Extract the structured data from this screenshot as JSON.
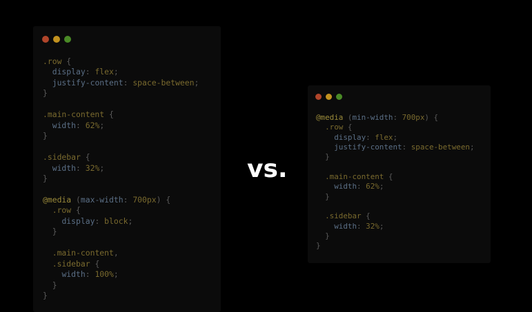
{
  "vs_label": "vs.",
  "colors": {
    "background": "#000000",
    "window": "#0b0b0b",
    "dot_red": "#b0452a",
    "dot_yellow": "#c2921f",
    "dot_green": "#4a8a26"
  },
  "left_window": {
    "dots": [
      "red",
      "yellow",
      "green"
    ],
    "lines": [
      [
        {
          "t": "sel",
          "v": ".row"
        },
        {
          "t": "punc",
          "v": " {"
        }
      ],
      [
        {
          "t": "punc",
          "v": "  "
        },
        {
          "t": "prop",
          "v": "display"
        },
        {
          "t": "punc",
          "v": ": "
        },
        {
          "t": "val",
          "v": "flex"
        },
        {
          "t": "punc",
          "v": ";"
        }
      ],
      [
        {
          "t": "punc",
          "v": "  "
        },
        {
          "t": "prop",
          "v": "justify-content"
        },
        {
          "t": "punc",
          "v": ": "
        },
        {
          "t": "val",
          "v": "space-between"
        },
        {
          "t": "punc",
          "v": ";"
        }
      ],
      [
        {
          "t": "punc",
          "v": "}"
        }
      ],
      [],
      [
        {
          "t": "sel",
          "v": ".main-content"
        },
        {
          "t": "punc",
          "v": " {"
        }
      ],
      [
        {
          "t": "punc",
          "v": "  "
        },
        {
          "t": "prop",
          "v": "width"
        },
        {
          "t": "punc",
          "v": ": "
        },
        {
          "t": "val",
          "v": "62%"
        },
        {
          "t": "punc",
          "v": ";"
        }
      ],
      [
        {
          "t": "punc",
          "v": "}"
        }
      ],
      [],
      [
        {
          "t": "sel",
          "v": ".sidebar"
        },
        {
          "t": "punc",
          "v": " {"
        }
      ],
      [
        {
          "t": "punc",
          "v": "  "
        },
        {
          "t": "prop",
          "v": "width"
        },
        {
          "t": "punc",
          "v": ": "
        },
        {
          "t": "val",
          "v": "32%"
        },
        {
          "t": "punc",
          "v": ";"
        }
      ],
      [
        {
          "t": "punc",
          "v": "}"
        }
      ],
      [],
      [
        {
          "t": "at",
          "v": "@media"
        },
        {
          "t": "punc",
          "v": " ("
        },
        {
          "t": "arg",
          "v": "max-width"
        },
        {
          "t": "punc",
          "v": ": "
        },
        {
          "t": "val",
          "v": "700px"
        },
        {
          "t": "punc",
          "v": ") {"
        }
      ],
      [
        {
          "t": "punc",
          "v": "  "
        },
        {
          "t": "sel",
          "v": ".row"
        },
        {
          "t": "punc",
          "v": " {"
        }
      ],
      [
        {
          "t": "punc",
          "v": "    "
        },
        {
          "t": "prop",
          "v": "display"
        },
        {
          "t": "punc",
          "v": ": "
        },
        {
          "t": "val",
          "v": "block"
        },
        {
          "t": "punc",
          "v": ";"
        }
      ],
      [
        {
          "t": "punc",
          "v": "  }"
        }
      ],
      [],
      [
        {
          "t": "punc",
          "v": "  "
        },
        {
          "t": "sel",
          "v": ".main-content"
        },
        {
          "t": "punc",
          "v": ","
        }
      ],
      [
        {
          "t": "punc",
          "v": "  "
        },
        {
          "t": "sel",
          "v": ".sidebar"
        },
        {
          "t": "punc",
          "v": " {"
        }
      ],
      [
        {
          "t": "punc",
          "v": "    "
        },
        {
          "t": "prop",
          "v": "width"
        },
        {
          "t": "punc",
          "v": ": "
        },
        {
          "t": "val",
          "v": "100%"
        },
        {
          "t": "punc",
          "v": ";"
        }
      ],
      [
        {
          "t": "punc",
          "v": "  }"
        }
      ],
      [
        {
          "t": "punc",
          "v": "}"
        }
      ]
    ]
  },
  "right_window": {
    "dots": [
      "red",
      "yellow",
      "green"
    ],
    "lines": [
      [
        {
          "t": "at",
          "v": "@media"
        },
        {
          "t": "punc",
          "v": " ("
        },
        {
          "t": "arg",
          "v": "min-width"
        },
        {
          "t": "punc",
          "v": ": "
        },
        {
          "t": "val",
          "v": "700px"
        },
        {
          "t": "punc",
          "v": ") {"
        }
      ],
      [
        {
          "t": "punc",
          "v": "  "
        },
        {
          "t": "sel",
          "v": ".row"
        },
        {
          "t": "punc",
          "v": " {"
        }
      ],
      [
        {
          "t": "punc",
          "v": "    "
        },
        {
          "t": "prop",
          "v": "display"
        },
        {
          "t": "punc",
          "v": ": "
        },
        {
          "t": "val",
          "v": "flex"
        },
        {
          "t": "punc",
          "v": ";"
        }
      ],
      [
        {
          "t": "punc",
          "v": "    "
        },
        {
          "t": "prop",
          "v": "justify-content"
        },
        {
          "t": "punc",
          "v": ": "
        },
        {
          "t": "val",
          "v": "space-between"
        },
        {
          "t": "punc",
          "v": ";"
        }
      ],
      [
        {
          "t": "punc",
          "v": "  }"
        }
      ],
      [],
      [
        {
          "t": "punc",
          "v": "  "
        },
        {
          "t": "sel",
          "v": ".main-content"
        },
        {
          "t": "punc",
          "v": " {"
        }
      ],
      [
        {
          "t": "punc",
          "v": "    "
        },
        {
          "t": "prop",
          "v": "width"
        },
        {
          "t": "punc",
          "v": ": "
        },
        {
          "t": "val",
          "v": "62%"
        },
        {
          "t": "punc",
          "v": ";"
        }
      ],
      [
        {
          "t": "punc",
          "v": "  }"
        }
      ],
      [],
      [
        {
          "t": "punc",
          "v": "  "
        },
        {
          "t": "sel",
          "v": ".sidebar"
        },
        {
          "t": "punc",
          "v": " {"
        }
      ],
      [
        {
          "t": "punc",
          "v": "    "
        },
        {
          "t": "prop",
          "v": "width"
        },
        {
          "t": "punc",
          "v": ": "
        },
        {
          "t": "val",
          "v": "32%"
        },
        {
          "t": "punc",
          "v": ";"
        }
      ],
      [
        {
          "t": "punc",
          "v": "  }"
        }
      ],
      [
        {
          "t": "punc",
          "v": "}"
        }
      ]
    ]
  }
}
